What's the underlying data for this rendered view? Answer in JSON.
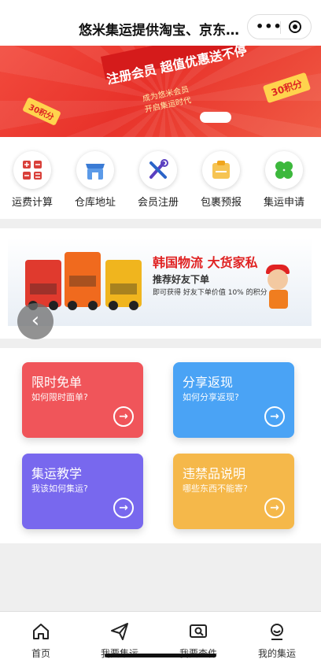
{
  "nav": {
    "title": "悠米集运提供淘宝、京东…",
    "more_label": "•••"
  },
  "banner": {
    "headline": "注册会员  超值优惠送不停",
    "line1": "成为悠米会员",
    "line2": "开启集运时代",
    "badge_right": "30积分",
    "badge_left": "30积分"
  },
  "icons": [
    {
      "label": "运费计算",
      "icon": "calculator-icon",
      "color": "#d9403a"
    },
    {
      "label": "仓库地址",
      "icon": "store-icon",
      "color": "#3a7bd5"
    },
    {
      "label": "会员注册",
      "icon": "tools-icon",
      "color": "#5a3fc0"
    },
    {
      "label": "包裹预报",
      "icon": "package-icon",
      "color": "#f0a51b"
    },
    {
      "label": "集运申请",
      "icon": "clover-icon",
      "color": "#3cb83c"
    }
  ],
  "truck_banner": {
    "title": "韩国物流 大货家私",
    "sub1": "推荐好友下单",
    "sub2": "即可获得 好友下单价值 10% 的积分"
  },
  "cards": [
    {
      "title": "限时免单",
      "sub": "如何限时面单?",
      "color": "#f0555a"
    },
    {
      "title": "分享返现",
      "sub": "如何分享返现?",
      "color": "#4aa3f5"
    },
    {
      "title": "集运教学",
      "sub": "我该如何集运?",
      "color": "#7868ee"
    },
    {
      "title": "违禁品说明",
      "sub": "哪些东西不能寄?",
      "color": "#f5b84a"
    }
  ],
  "tabs": [
    {
      "label": "首页",
      "icon": "home-icon"
    },
    {
      "label": "我要集运",
      "icon": "send-icon"
    },
    {
      "label": "我要查件",
      "icon": "search-package-icon"
    },
    {
      "label": "我的集运",
      "icon": "user-icon"
    }
  ]
}
